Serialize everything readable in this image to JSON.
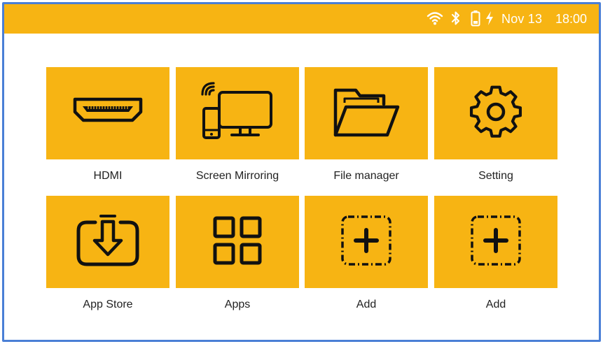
{
  "status_bar": {
    "date": "Nov 13",
    "time": "18:00",
    "icons": [
      "wifi-icon",
      "bluetooth-icon",
      "battery-icon",
      "charging-icon"
    ]
  },
  "apps": [
    {
      "label": "HDMI",
      "icon": "hdmi-icon"
    },
    {
      "label": "Screen Mirroring",
      "icon": "screen-mirroring-icon"
    },
    {
      "label": "File manager",
      "icon": "folder-icon"
    },
    {
      "label": "Setting",
      "icon": "gear-icon"
    },
    {
      "label": "App Store",
      "icon": "download-icon"
    },
    {
      "label": "Apps",
      "icon": "grid-icon"
    },
    {
      "label": "Add",
      "icon": "add-icon"
    },
    {
      "label": "Add",
      "icon": "add-icon"
    }
  ],
  "colors": {
    "accent": "#f7b413",
    "border": "#4a7fd6",
    "icon": "#111111"
  }
}
